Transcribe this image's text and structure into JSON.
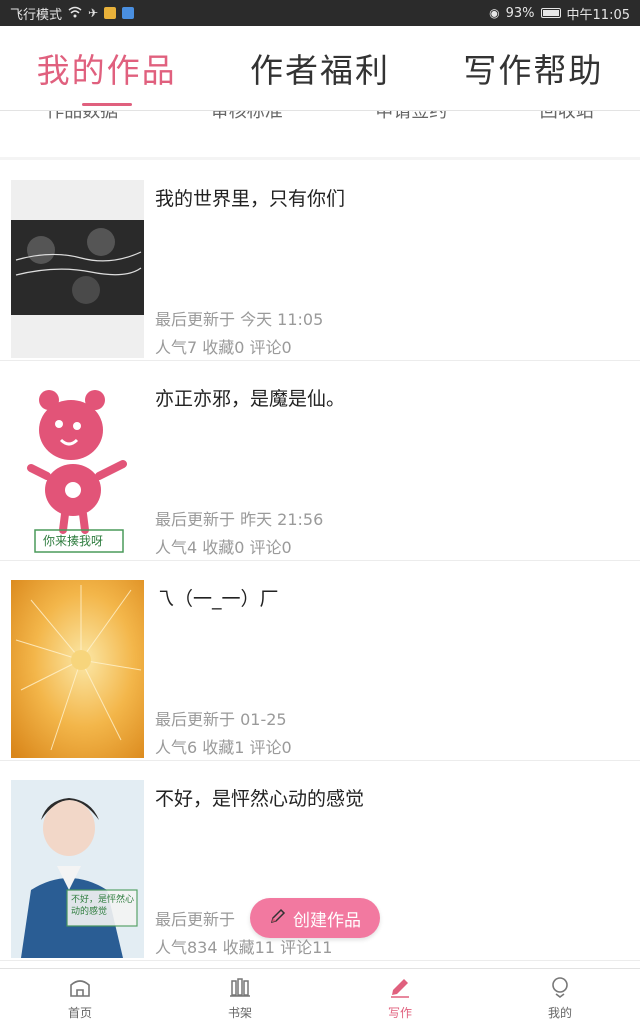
{
  "status_bar": {
    "left_text": "飞行模式",
    "battery": "93%",
    "time": "中午11:05"
  },
  "top_tabs": [
    {
      "label": "我的作品",
      "active": true
    },
    {
      "label": "作者福利",
      "active": false
    },
    {
      "label": "写作帮助",
      "active": false
    }
  ],
  "sub_nav": [
    "作品数据",
    "审核标准",
    "申请签约",
    "回收站"
  ],
  "works": [
    {
      "title": "我的世界里，只有你们",
      "updated": "最后更新于 今天 11:05",
      "stats": "人气7 收藏0 评论0",
      "cover_icon": "group-photo-cover"
    },
    {
      "title": "亦正亦邪，是魔是仙。",
      "updated": "最后更新于 昨天 21:56",
      "stats": "人气4 收藏0 评论0",
      "cover_icon": "pink-bear-cover",
      "cover_caption": "你来揍我呀"
    },
    {
      "title": "乁（一_一）厂",
      "updated": "最后更新于 01-25",
      "stats": "人气6 收藏1 评论0",
      "cover_icon": "dandelion-cover"
    },
    {
      "title": "不好，是怦然心动的感觉",
      "updated": "最后更新于",
      "stats": "人气834 收藏11 评论11",
      "cover_icon": "portrait-cover",
      "cover_caption": "不好，是怦然心动的感觉"
    }
  ],
  "fab": {
    "label": "创建作品",
    "icon": "pencil-icon"
  },
  "bottom_nav": [
    {
      "label": "首页",
      "icon": "home-icon",
      "active": false
    },
    {
      "label": "书架",
      "icon": "bookshelf-icon",
      "active": false
    },
    {
      "label": "写作",
      "icon": "pencil-icon",
      "active": true
    },
    {
      "label": "我的",
      "icon": "profile-icon",
      "active": false
    }
  ],
  "colors": {
    "accent": "#e0607e",
    "fab": "#f279a0",
    "status_bar": "#2b2b2b"
  }
}
